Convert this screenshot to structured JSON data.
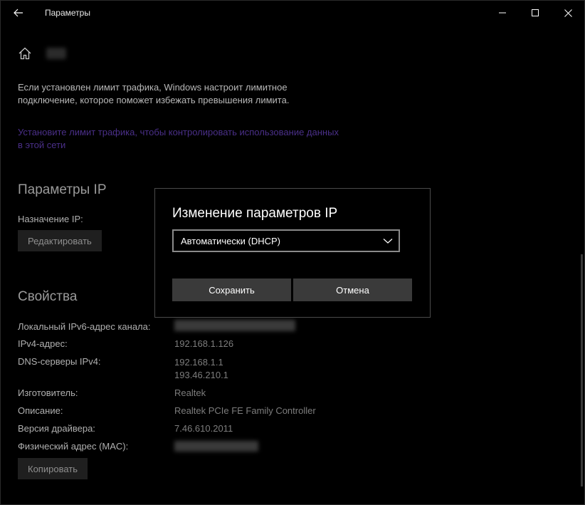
{
  "window": {
    "title": "Параметры"
  },
  "content": {
    "paragraph": "Если установлен лимит трафика, Windows настроит лимитное подключение, которое поможет избежать превышения лимита.",
    "link": "Установите лимит трафика, чтобы контролировать использование данных в этой сети",
    "ip_section": {
      "title": "Параметры IP",
      "assignment_label": "Назначение IP:",
      "edit_button": "Редактировать"
    },
    "properties_section": {
      "title": "Свойства",
      "rows": [
        {
          "label": "Локальный IPv6-адрес канала:",
          "value": ""
        },
        {
          "label": "IPv4-адрес:",
          "value": "192.168.1.126"
        },
        {
          "label": "DNS-серверы IPv4:",
          "value": "192.168.1.1",
          "value2": "193.46.210.1"
        },
        {
          "label": "Изготовитель:",
          "value": "Realtek"
        },
        {
          "label": "Описание:",
          "value": "Realtek PCIe FE Family Controller"
        },
        {
          "label": "Версия драйвера:",
          "value": "7.46.610.2011"
        },
        {
          "label": "Физический адрес (MAC):",
          "value": ""
        }
      ],
      "copy_button": "Копировать"
    }
  },
  "modal": {
    "title": "Изменение параметров IP",
    "select_value": "Автоматически (DHCP)",
    "save_button": "Сохранить",
    "cancel_button": "Отмена"
  },
  "colors": {
    "background": "#000000",
    "link": "#4a2f88",
    "modal_button": "#3a3a3a"
  }
}
